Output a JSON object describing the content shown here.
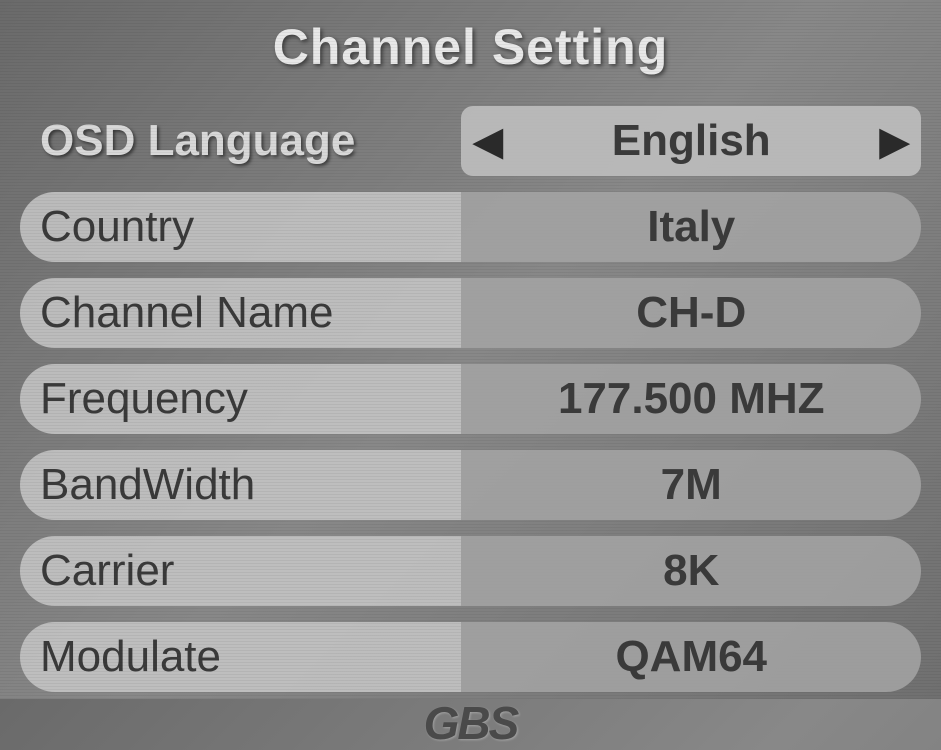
{
  "title": "Channel Setting",
  "rows": [
    {
      "label": "OSD Language",
      "value": "English",
      "selected": true
    },
    {
      "label": "Country",
      "value": "Italy",
      "selected": false
    },
    {
      "label": "Channel Name",
      "value": "CH-D",
      "selected": false
    },
    {
      "label": "Frequency",
      "value": "177.500 MHZ",
      "selected": false
    },
    {
      "label": "BandWidth",
      "value": "7M",
      "selected": false
    },
    {
      "label": "Carrier",
      "value": "8K",
      "selected": false
    },
    {
      "label": "Modulate",
      "value": "QAM64",
      "selected": false
    }
  ],
  "brand": "GBS"
}
